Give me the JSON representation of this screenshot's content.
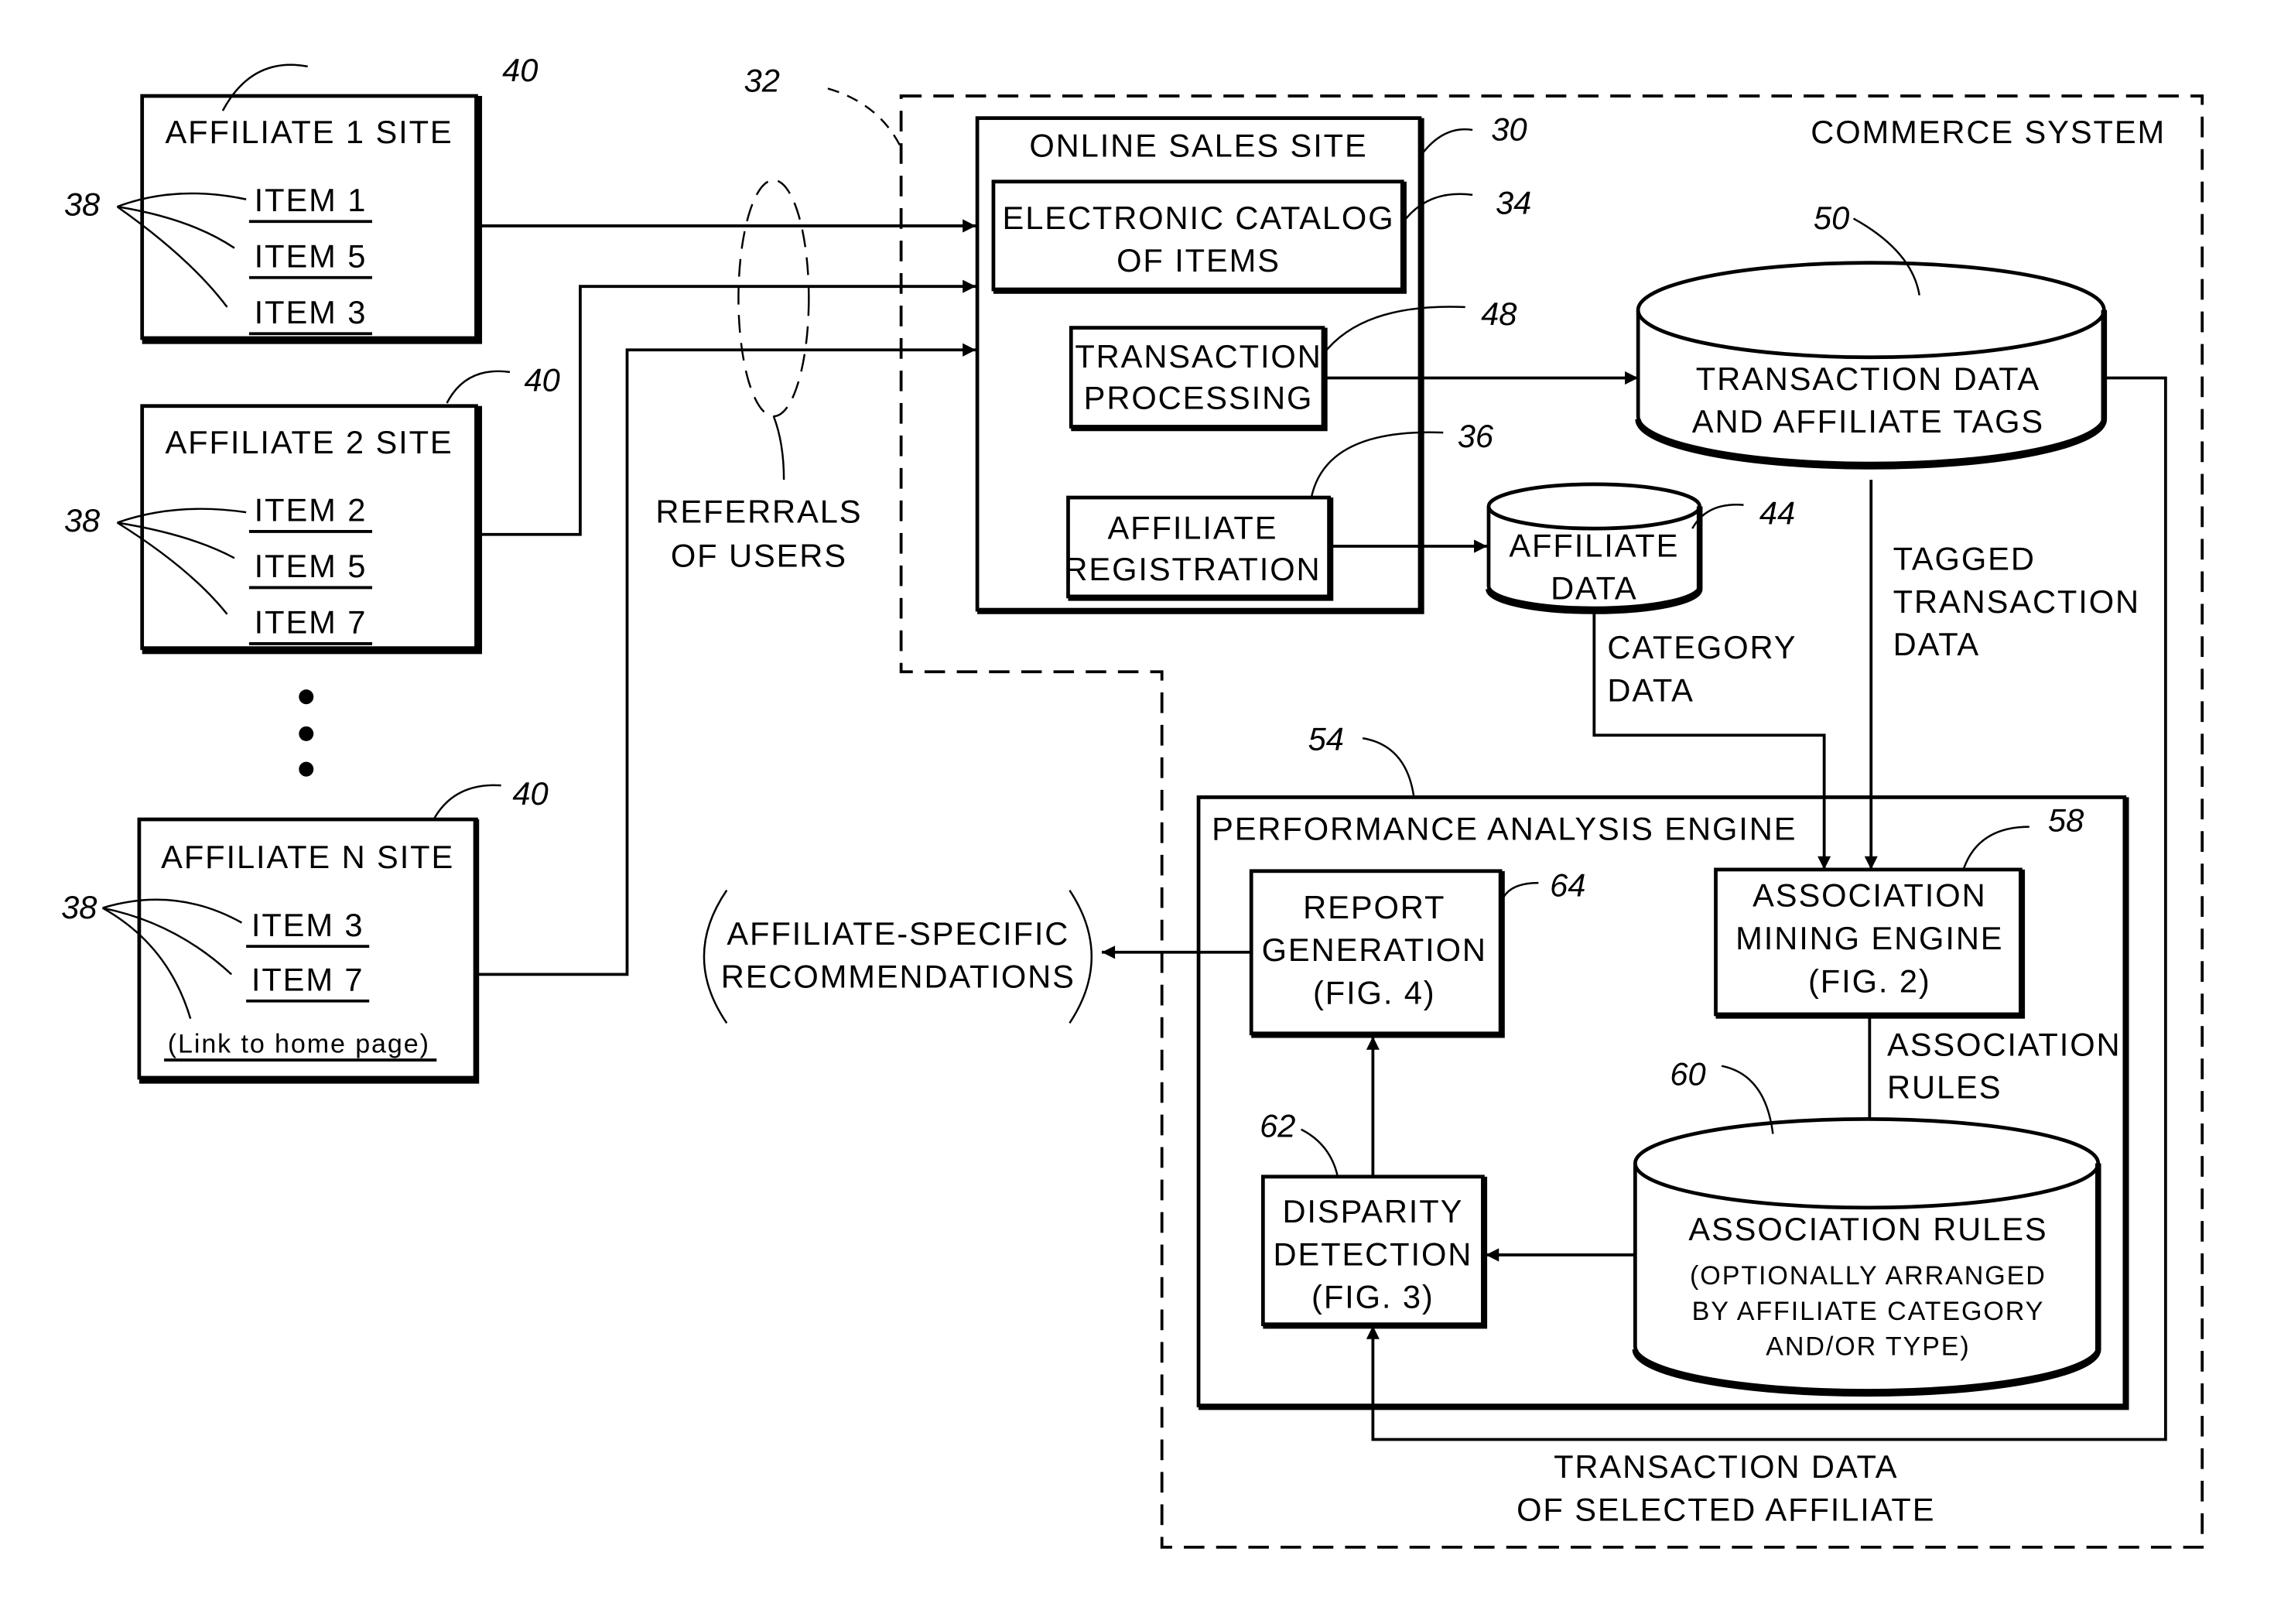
{
  "affiliates": [
    {
      "title": "AFFILIATE 1 SITE",
      "ref": "40",
      "items_ref": "38",
      "items": [
        "ITEM 1",
        "ITEM 5",
        "ITEM 3"
      ]
    },
    {
      "title": "AFFILIATE 2 SITE",
      "ref": "40",
      "items_ref": "38",
      "items": [
        "ITEM 2",
        "ITEM 5",
        "ITEM 7"
      ]
    },
    {
      "title": "AFFILIATE N SITE",
      "ref": "40",
      "items_ref": "38",
      "items": [
        "ITEM 3",
        "ITEM 7"
      ],
      "link": "(Link to home page)"
    }
  ],
  "referrals": {
    "ref": "32",
    "line1": "REFERRALS",
    "line2": "OF USERS"
  },
  "commerce_system": {
    "label": "COMMERCE SYSTEM"
  },
  "online_sales_site": {
    "title": "ONLINE SALES SITE",
    "ref": "30"
  },
  "catalog": {
    "line1": "ELECTRONIC CATALOG",
    "line2": "OF ITEMS",
    "ref": "34"
  },
  "transaction_processing": {
    "line1": "TRANSACTION",
    "line2": "PROCESSING",
    "ref": "48"
  },
  "affiliate_registration": {
    "line1": "AFFILIATE",
    "line2": "REGISTRATION",
    "ref": "36"
  },
  "transaction_db": {
    "line1": "TRANSACTION DATA",
    "line2": "AND AFFILIATE TAGS",
    "ref": "50"
  },
  "affiliate_db": {
    "line1": "AFFILIATE",
    "line2": "DATA",
    "ref": "44"
  },
  "category_data": {
    "line1": "CATEGORY",
    "line2": "DATA"
  },
  "tagged_data": {
    "line1": "TAGGED",
    "line2": "TRANSACTION",
    "line3": "DATA"
  },
  "engine": {
    "title": "PERFORMANCE ANALYSIS ENGINE",
    "ref": "54"
  },
  "mining": {
    "line1": "ASSOCIATION",
    "line2": "MINING ENGINE",
    "line3": "(FIG. 2)",
    "ref": "58"
  },
  "assoc_rules_label": {
    "line1": "ASSOCIATION",
    "line2": "RULES"
  },
  "rules_db": {
    "title": "ASSOCIATION RULES",
    "line1": "(OPTIONALLY ARRANGED",
    "line2": "BY AFFILIATE CATEGORY",
    "line3": "AND/OR TYPE)",
    "ref": "60"
  },
  "report": {
    "line1": "REPORT",
    "line2": "GENERATION",
    "line3": "(FIG. 4)",
    "ref": "64"
  },
  "disparity": {
    "line1": "DISPARITY",
    "line2": "DETECTION",
    "line3": "(FIG. 3)",
    "ref": "62"
  },
  "recommendations": {
    "line1": "AFFILIATE-SPECIFIC",
    "line2": "RECOMMENDATIONS"
  },
  "selected_data": {
    "line1": "TRANSACTION DATA",
    "line2": "OF SELECTED AFFILIATE"
  }
}
